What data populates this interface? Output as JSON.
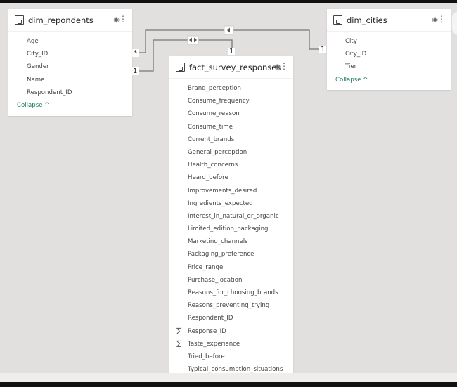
{
  "tables": [
    {
      "name": "dim_repondents",
      "fields": [
        {
          "name": "Age"
        },
        {
          "name": "City_ID"
        },
        {
          "name": "Gender"
        },
        {
          "name": "Name"
        },
        {
          "name": "Respondent_ID"
        }
      ],
      "collapse_label": "Collapse ^"
    },
    {
      "name": "dim_cities",
      "fields": [
        {
          "name": "City"
        },
        {
          "name": "City_ID"
        },
        {
          "name": "Tier"
        }
      ],
      "collapse_label": "Collapse ^"
    },
    {
      "name": "fact_survey_responses",
      "fields": [
        {
          "name": "Brand_perception"
        },
        {
          "name": "Consume_frequency"
        },
        {
          "name": "Consume_reason"
        },
        {
          "name": "Consume_time"
        },
        {
          "name": "Current_brands"
        },
        {
          "name": "General_perception"
        },
        {
          "name": "Health_concerns"
        },
        {
          "name": "Heard_before"
        },
        {
          "name": "Improvements_desired"
        },
        {
          "name": "Ingredients_expected"
        },
        {
          "name": "Interest_in_natural_or_organic"
        },
        {
          "name": "Limited_edition_packaging"
        },
        {
          "name": "Marketing_channels"
        },
        {
          "name": "Packaging_preference"
        },
        {
          "name": "Price_range"
        },
        {
          "name": "Purchase_location"
        },
        {
          "name": "Reasons_for_choosing_brands"
        },
        {
          "name": "Reasons_preventing_trying"
        },
        {
          "name": "Respondent_ID"
        },
        {
          "name": "Response_ID",
          "sum": "∑"
        },
        {
          "name": "Taste_experience",
          "sum": "∑"
        },
        {
          "name": "Tried_before"
        },
        {
          "name": "Typical_consumption_situations"
        }
      ]
    }
  ],
  "relationships": {
    "many": "*",
    "one": "1"
  },
  "icons": {
    "table": "table-icon",
    "visibility": "eye-icon",
    "more": "more-options-icon",
    "sum": "sigma-icon"
  },
  "colors": {
    "collapse": "#1f7a66",
    "canvas": "#e1e0de"
  }
}
